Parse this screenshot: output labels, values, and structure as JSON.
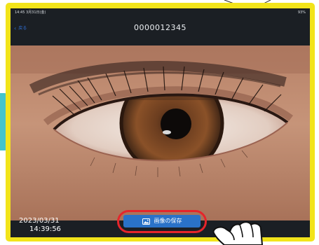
{
  "status_bar": {
    "time": "14:45  3月31日(金)",
    "battery": "93%"
  },
  "nav": {
    "back_label": "戻る",
    "record_id": "0000012345"
  },
  "capture": {
    "date": "2023/03/31",
    "time": "14:39:56"
  },
  "actions": {
    "save_label": "画像の保存",
    "save_icon": "image-icon"
  },
  "colors": {
    "frame": "#f2e41a",
    "accent_teal": "#43c4cc",
    "save_button": "#2a72c8",
    "highlight_ring": "#e5252b",
    "back_link": "#2f6fd6"
  }
}
